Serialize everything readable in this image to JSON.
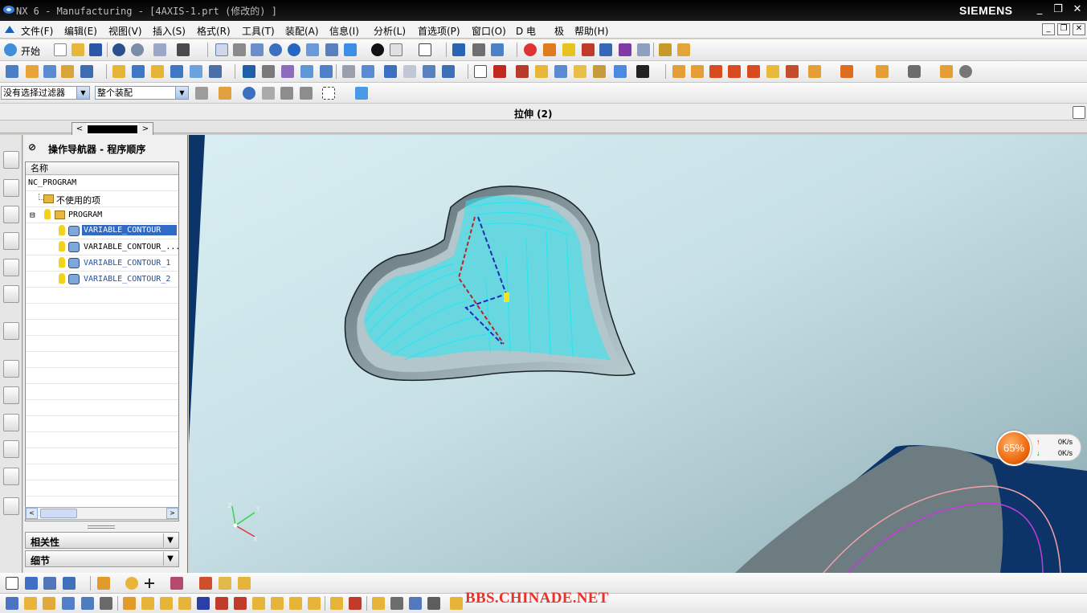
{
  "window": {
    "title": "NX 6 - Manufacturing - [4AXIS-1.prt  (修改的) ]",
    "brand": "SIEMENS",
    "min": "_",
    "max": "❐",
    "close": "✕"
  },
  "menu": {
    "items": [
      "文件(F)",
      "编辑(E)",
      "视图(V)",
      "插入(S)",
      "格式(R)",
      "工具(T)",
      "装配(A)",
      "信息(I)",
      "分析(L)",
      "首选项(P)",
      "窗口(O)",
      "D 电",
      "极",
      "帮助(H)"
    ],
    "mdi_min": "_",
    "mdi_restore": "❐",
    "mdi_close": "✕"
  },
  "toolbar": {
    "start_label": "开始",
    "filter_value": "没有选择过滤器",
    "scope_value": "整个装配",
    "dropdown_arrow": "▼"
  },
  "cue": {
    "title": "拉伸 (2)"
  },
  "resource_strip": {
    "left": "<",
    "right": ">"
  },
  "navigator": {
    "title": "操作导航器 - 程序顺序",
    "pin": "⊘",
    "column_header": "名称",
    "rows": [
      {
        "text": "NC_PROGRAM"
      },
      {
        "text": "不使用的项"
      },
      {
        "text": "PROGRAM"
      },
      {
        "text": "VARIABLE_CONTOUR"
      },
      {
        "text": "VARIABLE_CONTOUR_..."
      },
      {
        "text": "VARIABLE_CONTOUR_1"
      },
      {
        "text": "VARIABLE_CONTOUR_2"
      }
    ],
    "expand_symbol": "⊟",
    "scroll_left": "<",
    "scroll_right": ">",
    "panels": [
      {
        "label": "相关性",
        "chevron": "▼"
      },
      {
        "label": "细节",
        "chevron": "▼"
      }
    ]
  },
  "viewport": {
    "background": "#0d3468",
    "cylinder_color": "#c3dce2",
    "toolpath_color": "#2be5f2",
    "triad": {
      "x": "X",
      "y": "Y",
      "z": "Z"
    }
  },
  "net_widget": {
    "percent": "65%",
    "up_arrow": "↑",
    "down_arrow": "↓",
    "up_rate": "0K/s",
    "down_rate": "0K/s"
  },
  "watermark": "BBS.CHINADE.NET"
}
